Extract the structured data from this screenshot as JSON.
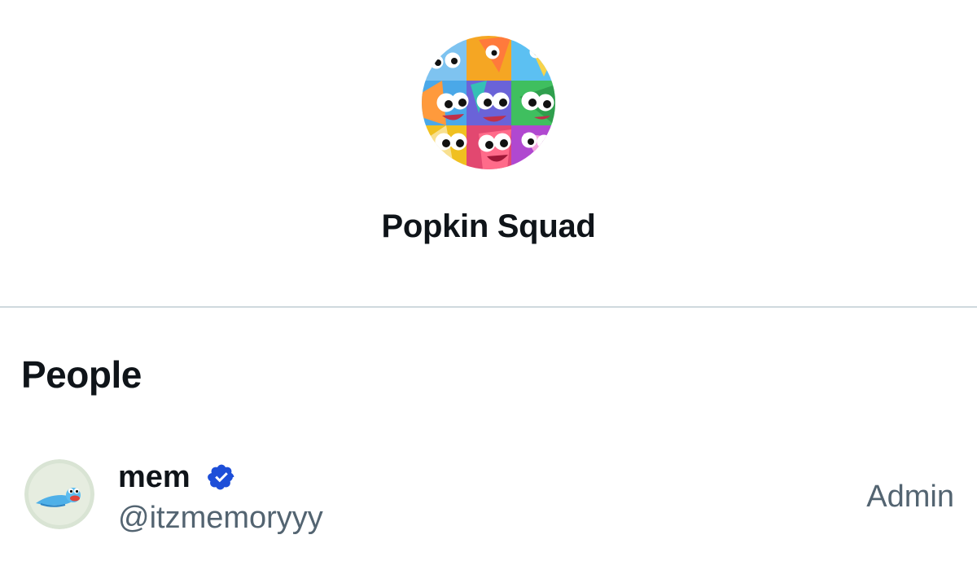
{
  "group": {
    "name": "Popkin Squad",
    "avatar_icon": "popkin-collage-avatar"
  },
  "people_section": {
    "title": "People",
    "members": [
      {
        "name": "mem",
        "handle": "@itzmemoryyy",
        "role": "Admin",
        "verified": true,
        "avatar_icon": "blue-bird-avatar"
      }
    ]
  },
  "colors": {
    "text_primary": "#0f1419",
    "text_secondary": "#536471",
    "divider": "#cfd9de",
    "verified_badge": "#1d4ed8"
  }
}
